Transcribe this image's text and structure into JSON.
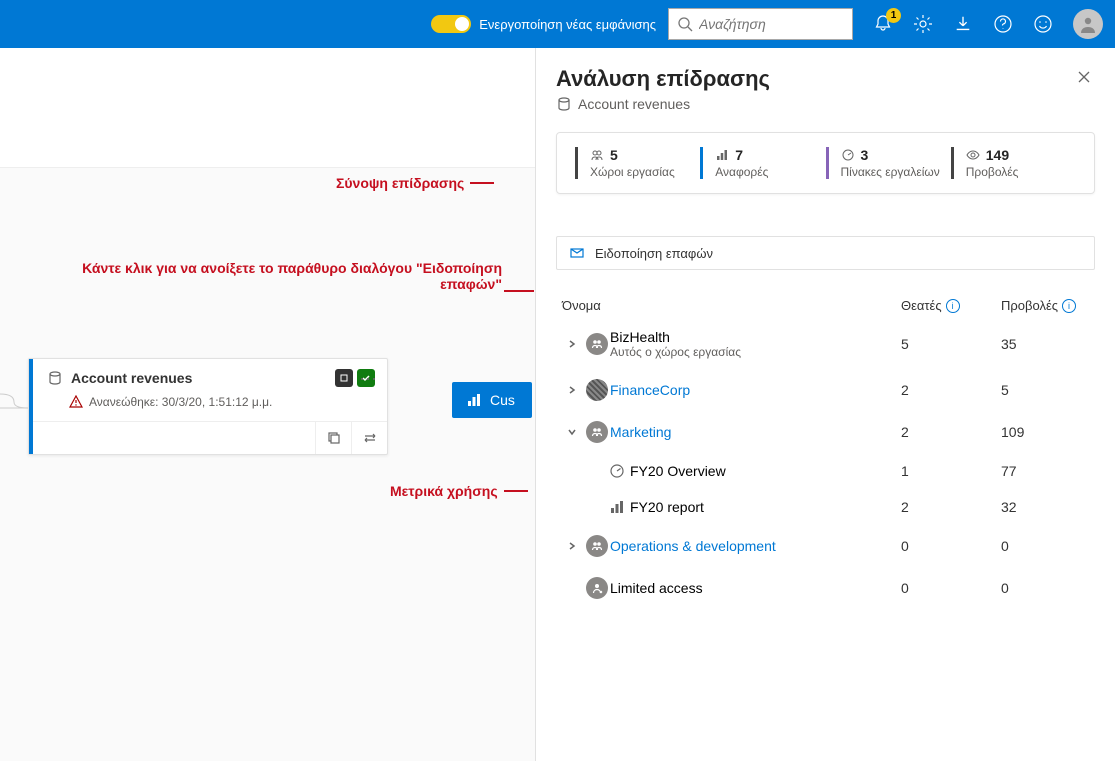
{
  "header": {
    "toggle_label": "Ενεργοποίηση νέας εμφάνισης",
    "search_placeholder": "Αναζήτηση",
    "notification_count": "1"
  },
  "canvas": {
    "card_title": "Account revenues",
    "card_refreshed": "Ανανεώθηκε: 30/3/20, 1:51:12 μ.μ.",
    "blue_card_label": "Cus"
  },
  "annotations": {
    "summary_label": "Σύνοψη επίδρασης",
    "notify_label": "Κάντε κλικ για να ανοίξετε το παράθυρο διαλόγου \"Ειδοποίηση επαφών\"",
    "metrics_label": "Μετρικά χρήσης"
  },
  "panel": {
    "title": "Ανάλυση επίδρασης",
    "subtitle": "Account revenues",
    "summary": {
      "workspaces": {
        "value": "5",
        "label": "Χώροι εργασίας"
      },
      "reports": {
        "value": "7",
        "label": "Αναφορές"
      },
      "dashboards": {
        "value": "3",
        "label": "Πίνακες εργαλείων"
      },
      "views": {
        "value": "149",
        "label": "Προβολές"
      }
    },
    "notify_contacts": "Ειδοποίηση επαφών",
    "columns": {
      "name": "Όνομα",
      "viewers": "Θεατές",
      "views": "Προβολές"
    },
    "rows": [
      {
        "name": "BizHealth",
        "subtext": "Αυτός ο χώρος εργασίας",
        "viewers": "5",
        "views": "35",
        "type": "ws",
        "expandable": true,
        "open": false,
        "link": false
      },
      {
        "name": "FinanceCorp",
        "viewers": "2",
        "views": "5",
        "type": "ws-img",
        "expandable": true,
        "open": false,
        "link": true
      },
      {
        "name": "Marketing",
        "viewers": "2",
        "views": "109",
        "type": "ws",
        "expandable": true,
        "open": true,
        "link": true
      },
      {
        "name": "FY20 Overview",
        "viewers": "1",
        "views": "77",
        "type": "dashboard",
        "child": true
      },
      {
        "name": "FY20 report",
        "viewers": "2",
        "views": "32",
        "type": "report",
        "child": true
      },
      {
        "name": "Operations & development",
        "viewers": "0",
        "views": "0",
        "type": "ws",
        "expandable": true,
        "open": false,
        "link": true
      },
      {
        "name": "Limited access",
        "viewers": "0",
        "views": "0",
        "type": "limited"
      }
    ]
  }
}
